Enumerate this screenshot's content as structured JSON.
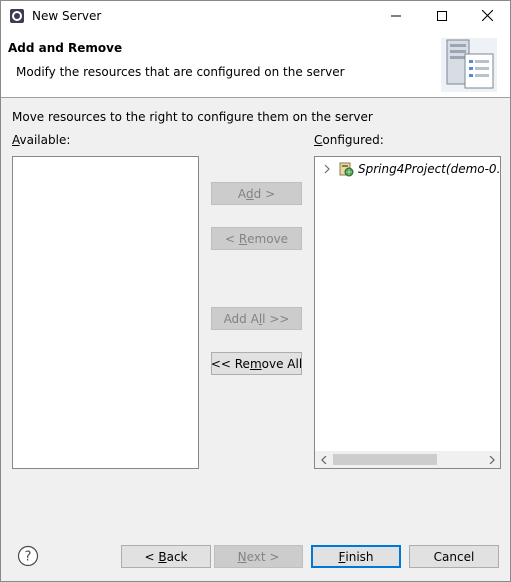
{
  "window": {
    "title": "New Server",
    "controls": {
      "minimize": "minimize-icon",
      "maximize": "maximize-icon",
      "close": "close-icon"
    }
  },
  "banner": {
    "title": "Add and Remove",
    "description": "Modify the resources that are configured on the server"
  },
  "main": {
    "instruction": "Move resources to the right to configure them on the server",
    "available_label": {
      "mnemonic": "A",
      "rest": "vailable:"
    },
    "configured_label": {
      "mnemonic": "C",
      "rest": "onfigured:"
    },
    "available_items": [],
    "configured_items": [
      {
        "label": "Spring4Project(demo-0.0.",
        "expanded": false
      }
    ]
  },
  "transfer_buttons": {
    "add": {
      "pre": "A",
      "mnemonic": "d",
      "post": "d >",
      "enabled": false
    },
    "remove": {
      "pre": "< ",
      "mnemonic": "R",
      "post": "emove",
      "enabled": false
    },
    "add_all": {
      "pre": "Add A",
      "mnemonic": "l",
      "post": "l >>",
      "enabled": false
    },
    "remove_all": {
      "pre": "<< Re",
      "mnemonic": "m",
      "post": "ove All",
      "enabled": true
    }
  },
  "footer": {
    "back": {
      "pre": "< ",
      "mnemonic": "B",
      "post": "ack",
      "enabled": true
    },
    "next": {
      "pre": "",
      "mnemonic": "N",
      "post": "ext >",
      "enabled": false
    },
    "finish": {
      "pre": "",
      "mnemonic": "F",
      "post": "inish",
      "enabled": true
    },
    "cancel": {
      "label": "Cancel",
      "enabled": true
    }
  },
  "colors": {
    "accent": "#0078d7",
    "dialog_bg": "#f0f0f0",
    "disabled_bg": "#cccccc"
  }
}
